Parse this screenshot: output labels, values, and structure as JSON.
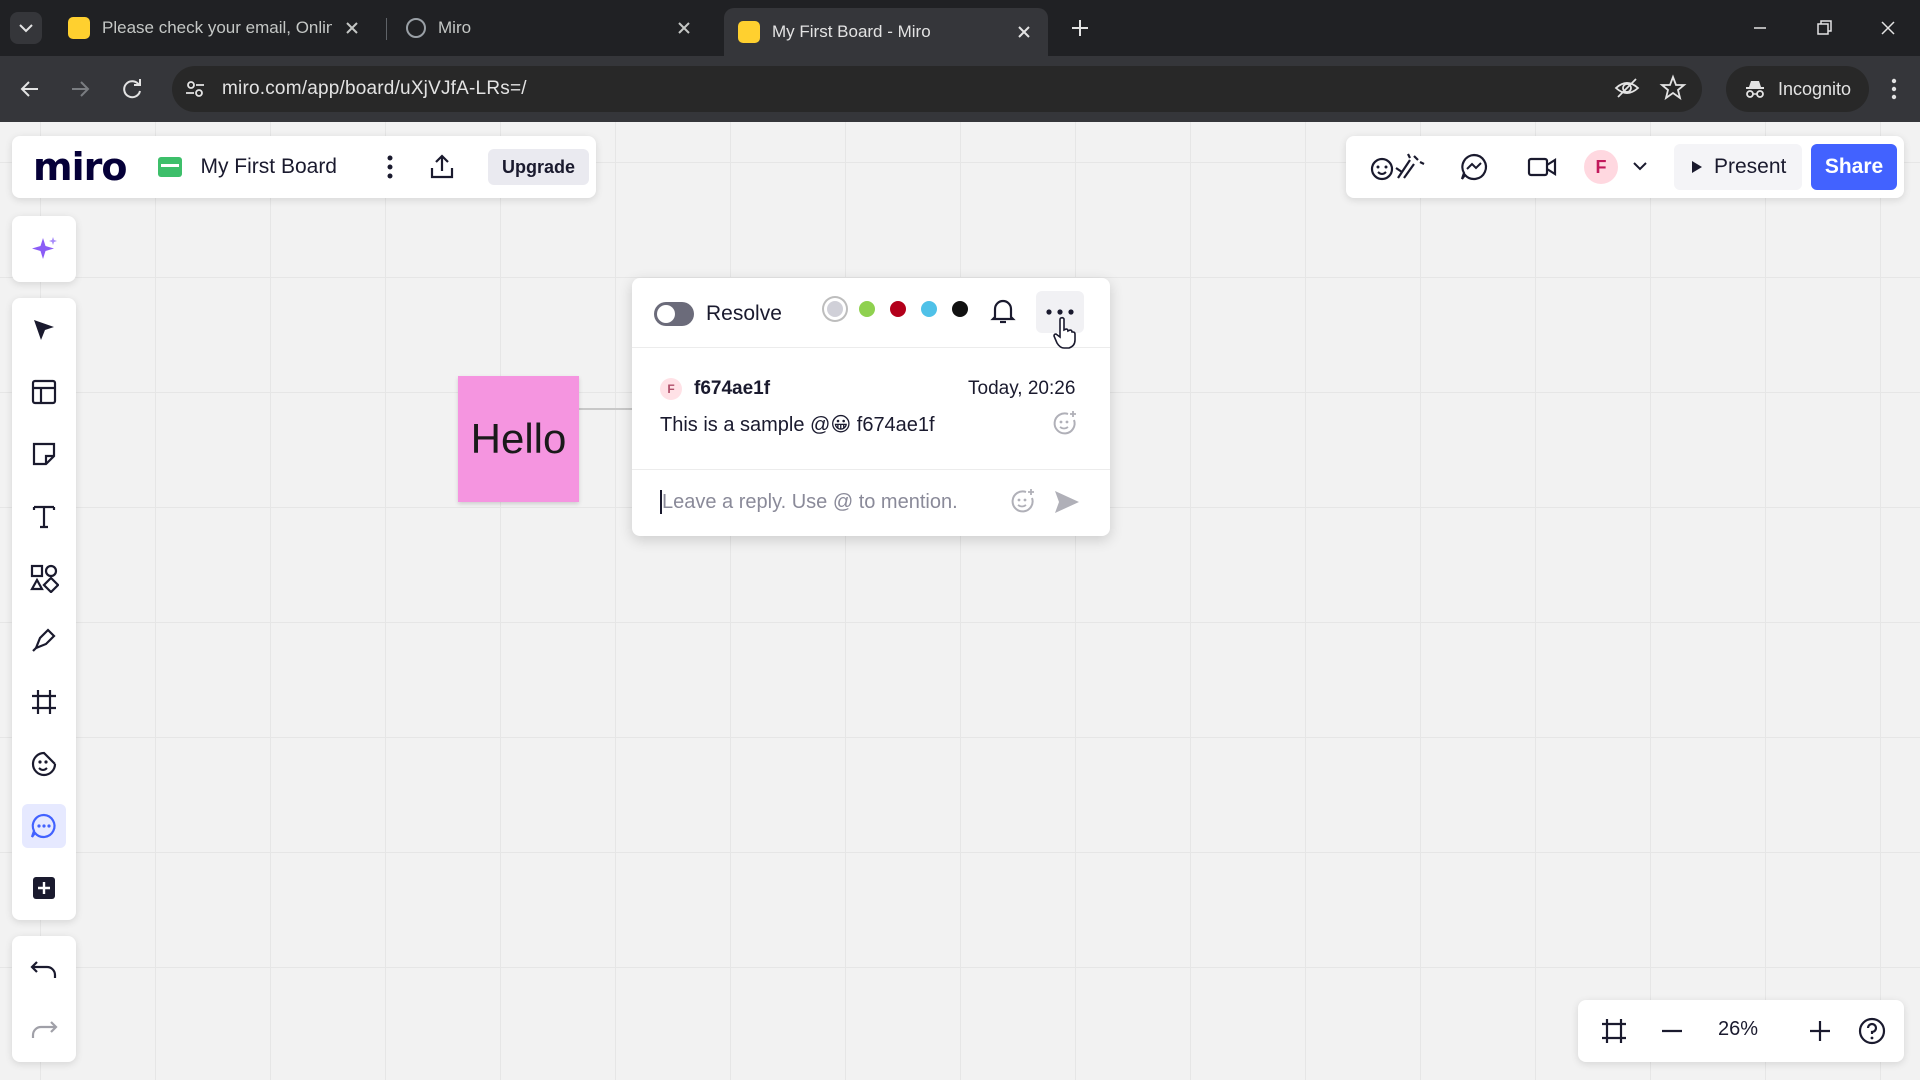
{
  "browser": {
    "tabs": [
      {
        "title": "Please check your email, Online",
        "favicon": "miro-logo-icon",
        "active": false
      },
      {
        "title": "Miro",
        "favicon": "globe-icon",
        "active": false
      },
      {
        "title": "My First Board - Miro",
        "favicon": "miro-logo-icon",
        "active": true
      }
    ],
    "url": "miro.com/app/board/uXjVJfA-LRs=/",
    "incognito_label": "Incognito"
  },
  "app": {
    "logo": "miro",
    "board_name": "My First Board",
    "upgrade_label": "Upgrade",
    "present_label": "Present",
    "share_label": "Share",
    "user_initial": "F",
    "accent_color": "#4262ff"
  },
  "toolbar": {
    "tools": [
      "ai-sparkle",
      "select",
      "templates",
      "sticky-note",
      "text",
      "shapes",
      "pen",
      "frame",
      "stickers",
      "comment",
      "more-tools"
    ],
    "active_tool": "comment"
  },
  "canvas": {
    "sticky_note": {
      "text": "Hello",
      "color": "#f595e0"
    }
  },
  "comment": {
    "resolve_label": "Resolve",
    "colors": [
      "#d0d0d8",
      "#8fd14f",
      "#b3001b",
      "#4fc1e8",
      "#111111"
    ],
    "author_initial": "F",
    "author": "f674ae1f",
    "timestamp": "Today, 20:26",
    "body": "This is a sample @😀 f674ae1f",
    "reply_placeholder": "Leave a reply. Use @ to mention."
  },
  "zoom": {
    "level": "26%"
  }
}
